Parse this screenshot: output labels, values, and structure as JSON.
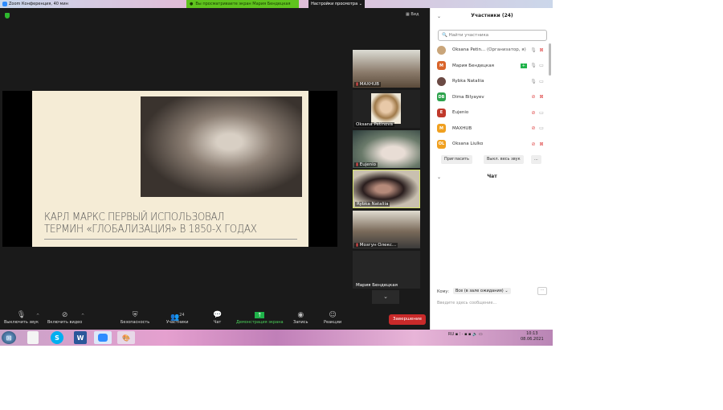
{
  "window": {
    "title": "Zoom Конференция, 40 мин"
  },
  "banner": {
    "text": "Вы просматриваете экран Мария Бендецкая",
    "view_options": "Настройки просмотра"
  },
  "stage": {
    "view_label": "Вид"
  },
  "slide": {
    "line1": "КАРЛ МАРКС ПЕРВЫЙ ИСПОЛЬЗОВАЛ",
    "line2": "ТЕРМИН «ГЛОБАЛИЗАЦИЯ» В 1850-Х ГОДАХ"
  },
  "thumbnails": [
    {
      "name": "MAXHUB",
      "muted": true
    },
    {
      "name": "Oksana Petinova",
      "muted": false
    },
    {
      "name": "Eujenio",
      "muted": true
    },
    {
      "name": "Rybka Nataliia",
      "muted": false,
      "active": true
    },
    {
      "name": "Мозгун Олекс...",
      "muted": true
    },
    {
      "name": "Мария Бендецкая",
      "muted": false
    }
  ],
  "toolbar": {
    "mute": "Выключить звук",
    "video": "Включить видео",
    "security": "Безопасность",
    "participants": "Участники",
    "participants_count": "24",
    "chat": "Чат",
    "share": "Демонстрация экрана",
    "record": "Запись",
    "reactions": "Реакции",
    "end": "Завершение"
  },
  "participants": {
    "title": "Участники (24)",
    "search_placeholder": "Найти участника",
    "items": [
      {
        "name": "Oksana Petin...",
        "role": "(Организатор, я)",
        "initials": "",
        "color": "#c9a57a",
        "mic": "on",
        "cam": "off"
      },
      {
        "name": "Мария Бендецкая",
        "role": "",
        "initials": "M",
        "color": "#d9652b",
        "mic": "on",
        "cam": "on",
        "sharing": true
      },
      {
        "name": "Rybka Nataliia",
        "role": "",
        "initials": "",
        "color": "#6b4a44",
        "mic": "on",
        "cam": "on"
      },
      {
        "name": "Dima Bilyayev",
        "role": "",
        "initials": "DB",
        "color": "#2ea34d",
        "mic": "off",
        "cam": "off"
      },
      {
        "name": "Eujenio",
        "role": "",
        "initials": "E",
        "color": "#c0392b",
        "mic": "off",
        "cam": "on"
      },
      {
        "name": "MAXHUB",
        "role": "",
        "initials": "M",
        "color": "#f0a020",
        "mic": "off",
        "cam": "on"
      },
      {
        "name": "Oksana Liulko",
        "role": "",
        "initials": "OL",
        "color": "#f0a020",
        "mic": "off",
        "cam": "off"
      }
    ],
    "invite": "Пригласить",
    "mute_all": "Выкл. весь звук",
    "more": "..."
  },
  "chat": {
    "title": "Чат",
    "to_label": "Кому:",
    "to_value": "Все (в зале ожидания)",
    "placeholder": "Введите здесь сообщение...",
    "more": "···"
  },
  "taskbar": {
    "lang": "RU",
    "time": "10:13",
    "date": "08.06.2021"
  }
}
